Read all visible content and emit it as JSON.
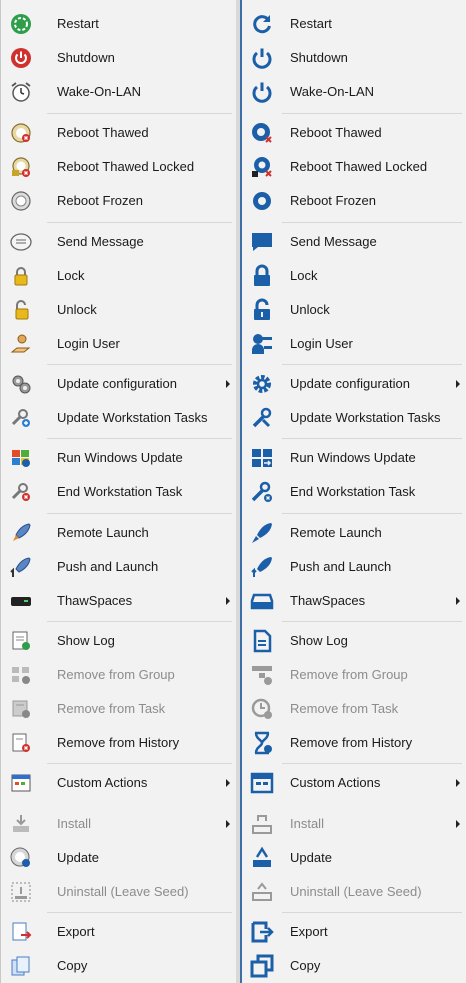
{
  "left_menu": {
    "items": [
      {
        "label": "Restart",
        "icon": "restart-icon",
        "submenu": false,
        "disabled": false
      },
      {
        "label": "Shutdown",
        "icon": "power-icon",
        "submenu": false,
        "disabled": false
      },
      {
        "label": "Wake-On-LAN",
        "icon": "alarm-clock-icon",
        "submenu": false,
        "disabled": false
      },
      {
        "label": "Reboot Thawed",
        "icon": "reboot-thawed-icon",
        "submenu": false,
        "disabled": false
      },
      {
        "label": "Reboot Thawed Locked",
        "icon": "reboot-thawed-locked-icon",
        "submenu": false,
        "disabled": false
      },
      {
        "label": "Reboot Frozen",
        "icon": "reboot-frozen-icon",
        "submenu": false,
        "disabled": false
      },
      {
        "label": "Send Message",
        "icon": "message-icon",
        "submenu": false,
        "disabled": false
      },
      {
        "label": "Lock",
        "icon": "lock-icon",
        "submenu": false,
        "disabled": false
      },
      {
        "label": "Unlock",
        "icon": "unlock-icon",
        "submenu": false,
        "disabled": false
      },
      {
        "label": "Login User",
        "icon": "login-user-icon",
        "submenu": false,
        "disabled": false
      },
      {
        "label": "Update configuration",
        "icon": "gears-icon",
        "submenu": true,
        "disabled": false
      },
      {
        "label": "Update Workstation Tasks",
        "icon": "tools-icon",
        "submenu": false,
        "disabled": false
      },
      {
        "label": "Run Windows Update",
        "icon": "windows-update-icon",
        "submenu": false,
        "disabled": false
      },
      {
        "label": "End Workstation Task",
        "icon": "end-task-icon",
        "submenu": false,
        "disabled": false
      },
      {
        "label": "Remote Launch",
        "icon": "rocket-icon",
        "submenu": false,
        "disabled": false
      },
      {
        "label": "Push and Launch",
        "icon": "push-launch-icon",
        "submenu": false,
        "disabled": false
      },
      {
        "label": "ThawSpaces",
        "icon": "drive-icon",
        "submenu": true,
        "disabled": false
      },
      {
        "label": "Show Log",
        "icon": "log-icon",
        "submenu": false,
        "disabled": false
      },
      {
        "label": "Remove from Group",
        "icon": "remove-group-icon",
        "submenu": false,
        "disabled": true
      },
      {
        "label": "Remove from Task",
        "icon": "remove-task-icon",
        "submenu": false,
        "disabled": true
      },
      {
        "label": "Remove from History",
        "icon": "remove-history-icon",
        "submenu": false,
        "disabled": false
      },
      {
        "label": "Custom Actions",
        "icon": "custom-actions-icon",
        "submenu": true,
        "disabled": false
      },
      {
        "label": "Install",
        "icon": "install-icon",
        "submenu": true,
        "disabled": true
      },
      {
        "label": "Update",
        "icon": "update-icon",
        "submenu": false,
        "disabled": false
      },
      {
        "label": "Uninstall (Leave Seed)",
        "icon": "uninstall-icon",
        "submenu": false,
        "disabled": true
      },
      {
        "label": "Export",
        "icon": "export-icon",
        "submenu": false,
        "disabled": false
      },
      {
        "label": "Copy",
        "icon": "copy-icon",
        "submenu": false,
        "disabled": false
      }
    ]
  },
  "right_menu": {
    "items": [
      {
        "label": "Restart",
        "icon": "restart-icon",
        "submenu": false,
        "disabled": false
      },
      {
        "label": "Shutdown",
        "icon": "power-icon",
        "submenu": false,
        "disabled": false
      },
      {
        "label": "Wake-On-LAN",
        "icon": "power-icon",
        "submenu": false,
        "disabled": false
      },
      {
        "label": "Reboot Thawed",
        "icon": "reboot-thawed-icon",
        "submenu": false,
        "disabled": false
      },
      {
        "label": "Reboot Thawed Locked",
        "icon": "reboot-thawed-locked-icon",
        "submenu": false,
        "disabled": false
      },
      {
        "label": "Reboot Frozen",
        "icon": "reboot-frozen-icon",
        "submenu": false,
        "disabled": false
      },
      {
        "label": "Send Message",
        "icon": "message-icon",
        "submenu": false,
        "disabled": false
      },
      {
        "label": "Lock",
        "icon": "lock-icon",
        "submenu": false,
        "disabled": false
      },
      {
        "label": "Unlock",
        "icon": "unlock-icon",
        "submenu": false,
        "disabled": false
      },
      {
        "label": "Login User",
        "icon": "login-user-icon",
        "submenu": false,
        "disabled": false
      },
      {
        "label": "Update configuration",
        "icon": "gear-icon",
        "submenu": true,
        "disabled": false
      },
      {
        "label": "Update Workstation Tasks",
        "icon": "tools-icon",
        "submenu": false,
        "disabled": false
      },
      {
        "label": "Run Windows Update",
        "icon": "windows-update-icon",
        "submenu": false,
        "disabled": false
      },
      {
        "label": "End Workstation Task",
        "icon": "end-task-icon",
        "submenu": false,
        "disabled": false
      },
      {
        "label": "Remote Launch",
        "icon": "rocket-icon",
        "submenu": false,
        "disabled": false
      },
      {
        "label": "Push and Launch",
        "icon": "push-launch-icon",
        "submenu": false,
        "disabled": false
      },
      {
        "label": "ThawSpaces",
        "icon": "drive-icon",
        "submenu": true,
        "disabled": false
      },
      {
        "label": "Show Log",
        "icon": "log-icon",
        "submenu": false,
        "disabled": false
      },
      {
        "label": "Remove from Group",
        "icon": "remove-group-icon",
        "submenu": false,
        "disabled": true
      },
      {
        "label": "Remove from Task",
        "icon": "remove-task-icon",
        "submenu": false,
        "disabled": true
      },
      {
        "label": "Remove from History",
        "icon": "hourglass-icon",
        "submenu": false,
        "disabled": false
      },
      {
        "label": "Custom Actions",
        "icon": "custom-actions-icon",
        "submenu": true,
        "disabled": false
      },
      {
        "label": "Install",
        "icon": "install-icon",
        "submenu": true,
        "disabled": true
      },
      {
        "label": "Update",
        "icon": "update-icon",
        "submenu": false,
        "disabled": false
      },
      {
        "label": "Uninstall (Leave Seed)",
        "icon": "uninstall-icon",
        "submenu": false,
        "disabled": true
      },
      {
        "label": "Export",
        "icon": "export-icon",
        "submenu": false,
        "disabled": false
      },
      {
        "label": "Copy",
        "icon": "copy-icon",
        "submenu": false,
        "disabled": false
      }
    ]
  },
  "colors": {
    "menu_background": "#f2f2f2",
    "accent_blue": "#1b5fa8",
    "icon_gray": "#7a7a7a",
    "danger_red": "#d0312d",
    "disabled_text": "#8c8c8c"
  }
}
